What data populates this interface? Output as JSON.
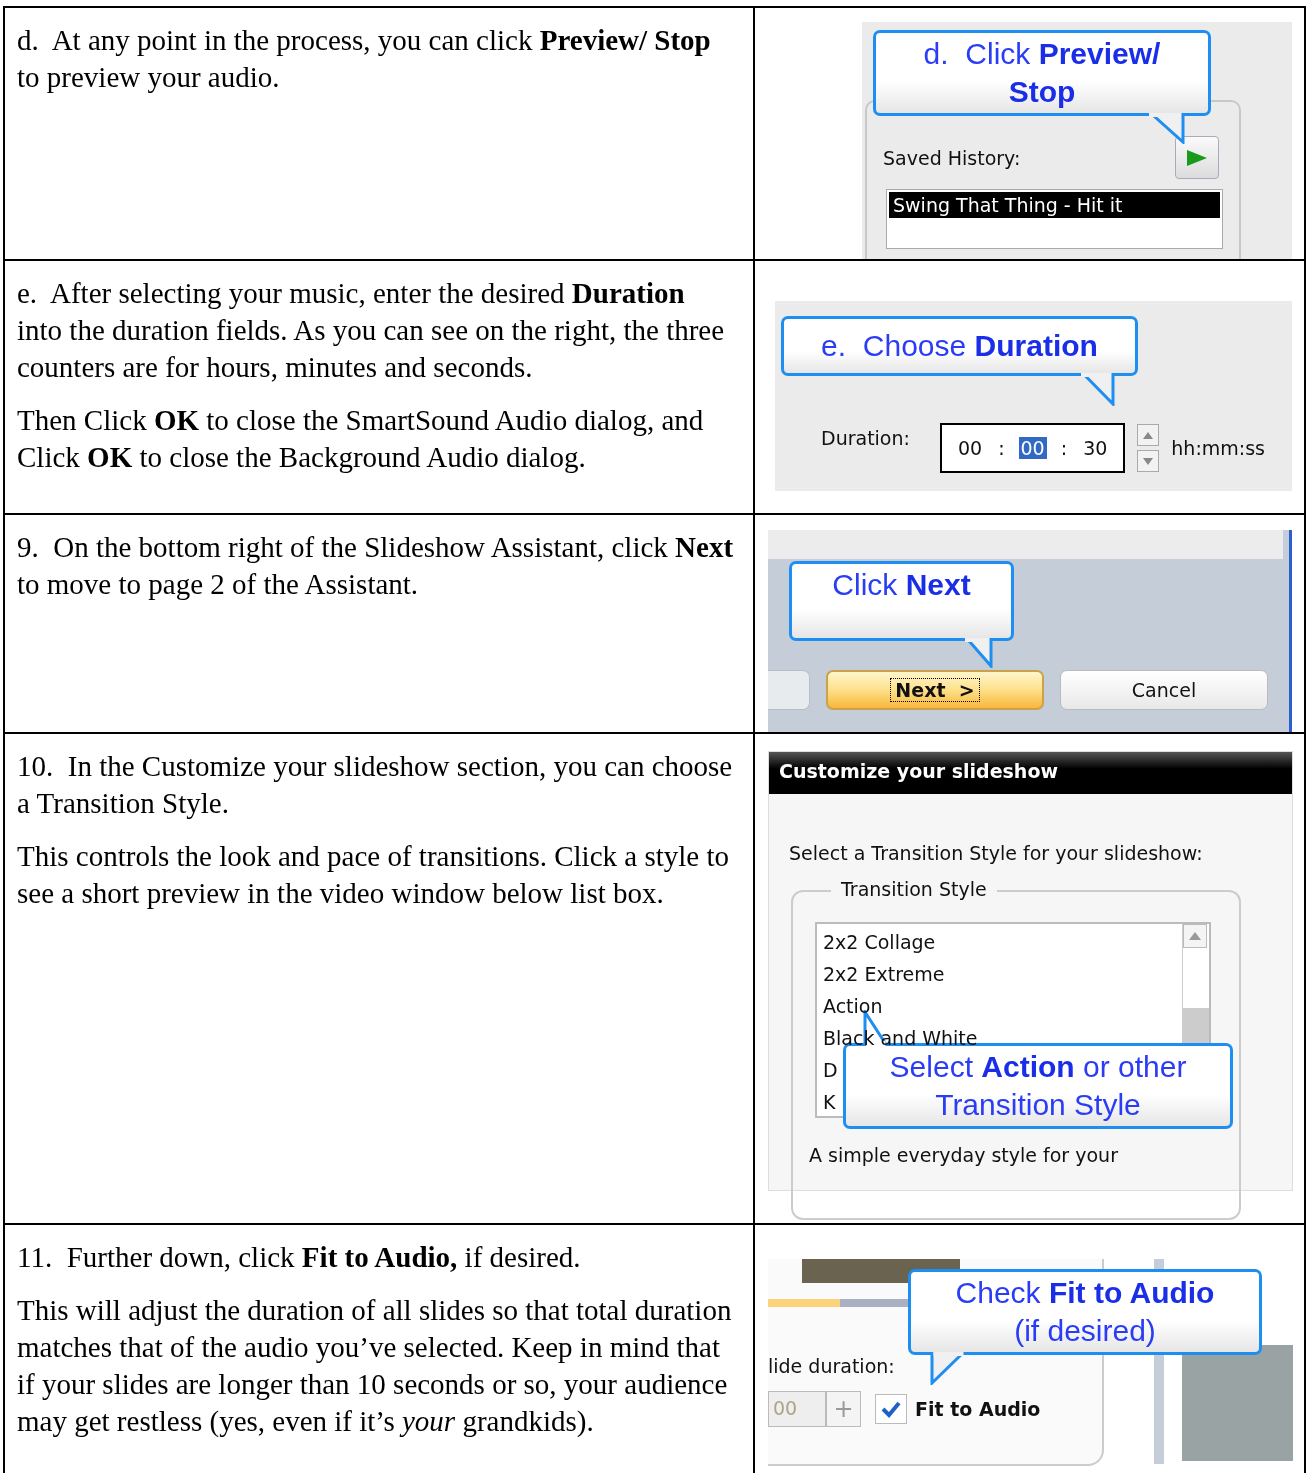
{
  "rows": [
    {
      "paragraphs": [
        "d.  At any point in the process, you can click **Preview/ Stop** to preview your audio."
      ],
      "panel": {
        "kind": "preview",
        "callout": [
          "d.  Click **Preview/**",
          "**Stop**"
        ],
        "label": "Saved History:",
        "list": [
          {
            "text": "Swing That Thing - Hit it",
            "selected": true
          }
        ]
      }
    },
    {
      "paragraphs": [
        "e.  After selecting your music, enter the desired **Duration** into the duration fields. As you can see on the right, the three counters are for hours, minutes and seconds.",
        "Then Click **OK** to close the SmartSound Audio dialog, and Click **OK** to close the Background Audio dialog."
      ],
      "panel": {
        "kind": "duration",
        "callout": [
          "e.  Choose **Duration**"
        ],
        "label": "Duration:",
        "parts": [
          {
            "kind": "segment",
            "text": "00",
            "selected": false
          },
          {
            "kind": "separator",
            "text": ":"
          },
          {
            "kind": "segment",
            "text": "00",
            "selected": true
          },
          {
            "kind": "separator",
            "text": ":"
          },
          {
            "kind": "segment",
            "text": "30",
            "selected": false
          }
        ],
        "unit": "hh:mm:ss"
      }
    },
    {
      "paragraphs": [
        "9.  On the bottom right of the Slideshow Assistant, click **Next** to move to page 2 of the Assistant."
      ],
      "panel": {
        "kind": "next",
        "callout": [
          "Click **Next**"
        ],
        "buttons": [
          {
            "label": "Next  >",
            "default": true
          },
          {
            "label": "Cancel",
            "default": false
          }
        ]
      }
    },
    {
      "paragraphs": [
        "10.  In the Customize your slideshow section, you can choose a Transition Style.",
        "This controls the look and pace of transitions. Click a style to see a short preview in the video window below list box."
      ],
      "panel": {
        "kind": "transition",
        "title": "Customize your slideshow",
        "prompt": "Select a Transition Style for your slideshow:",
        "group": "Transition Style",
        "items": [
          "2x2 Collage",
          "2x2 Extreme",
          "Action",
          "Black and White",
          "D",
          "K"
        ],
        "callout": [
          "Select **Action** or other",
          "Transition Style"
        ],
        "description": "A simple everyday style for your"
      }
    },
    {
      "paragraphs": [
        "11.  Further down, click **Fit to Audio,** if desired.",
        "This will adjust the duration of all slides so that total duration matches that of the audio you’ve selected. Keep in mind that if your slides are longer than 10 seconds or so, your audience may get restless (yes, even if it’s *your* grandkids)."
      ],
      "panel": {
        "kind": "fit",
        "callout": [
          "Check **Fit to Audio**",
          "(if desired)"
        ],
        "label": "lide duration:",
        "field": "00",
        "stepper": "+",
        "checkbox": {
          "label": "Fit to Audio",
          "checked": true
        }
      }
    }
  ]
}
